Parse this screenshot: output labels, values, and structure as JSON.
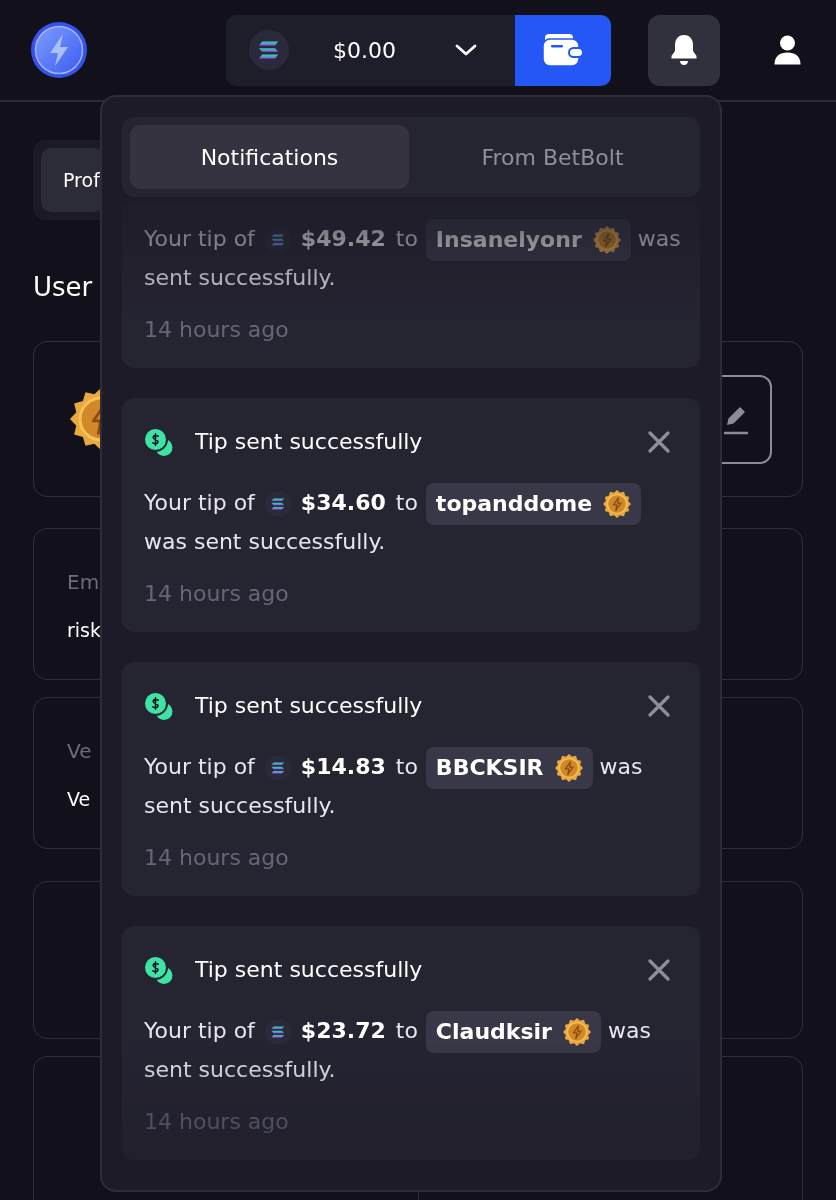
{
  "header": {
    "balance": "$0.00"
  },
  "profile_page": {
    "tabs": [
      {
        "label": "Prof",
        "selected": true
      }
    ],
    "heading": "User",
    "fields": [
      {
        "label": "Em",
        "value": "risk"
      },
      {
        "label": "Ve",
        "value": "Ve"
      }
    ]
  },
  "notifications_panel": {
    "tabs": [
      {
        "label": "Notifications",
        "selected": true
      },
      {
        "label": "From BetBolt",
        "selected": false
      }
    ],
    "items": [
      {
        "message": {
          "prefix": "Your tip of",
          "amount": "$49.42",
          "connector": "to",
          "recipient": "Insanelyonr",
          "suffix": [
            "was",
            "sent successfully."
          ]
        },
        "time": "14 hours ago"
      },
      {
        "title": "Tip sent successfully",
        "message": {
          "prefix": "Your tip of",
          "amount": "$34.60",
          "connector": "to",
          "recipient": "topanddome",
          "suffix": [
            "was sent successfully."
          ]
        },
        "time": "14 hours ago"
      },
      {
        "title": "Tip sent successfully",
        "message": {
          "prefix": "Your tip of",
          "amount": "$14.83",
          "connector": "to",
          "recipient": "BBCKSIR",
          "suffix": [
            "was",
            "sent successfully."
          ]
        },
        "time": "14 hours ago"
      },
      {
        "title": "Tip sent successfully",
        "message": {
          "prefix": "Your tip of",
          "amount": "$23.72",
          "connector": "to",
          "recipient": "Claudksir",
          "suffix": [
            "was",
            "sent successfully."
          ]
        },
        "time": "14 hours ago"
      }
    ]
  }
}
